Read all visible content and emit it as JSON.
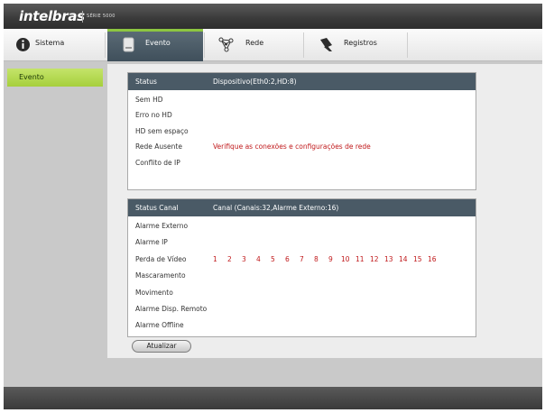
{
  "header": {
    "logo_text": "intelbras",
    "series_text": "SÉRIE 5000"
  },
  "tabs": [
    {
      "label": "Sistema",
      "icon": "info-icon"
    },
    {
      "label": "Evento",
      "icon": "hdd-icon",
      "active": true
    },
    {
      "label": "Rede",
      "icon": "network-icon"
    },
    {
      "label": "Registros",
      "icon": "log-icon"
    }
  ],
  "sidebar": {
    "items": [
      {
        "label": "Evento",
        "selected": true
      }
    ]
  },
  "status_panel": {
    "header_label": "Status",
    "header_value": "Dispositivo(Eth0:2,HD:8)",
    "rows": [
      {
        "label": "Sem HD",
        "value": ""
      },
      {
        "label": "Erro no HD",
        "value": ""
      },
      {
        "label": "HD sem espaço",
        "value": ""
      },
      {
        "label": "Rede Ausente",
        "value": "Verifique as conexões e configurações de rede"
      },
      {
        "label": "Conflito de IP",
        "value": ""
      }
    ]
  },
  "channel_panel": {
    "header_label": "Status Canal",
    "header_value": "Canal (Canais:32,Alarme Externo:16)",
    "rows": [
      {
        "label": "Alarme Externo"
      },
      {
        "label": "Alarme IP"
      },
      {
        "label": "Perda de Vídeo"
      },
      {
        "label": "Mascaramento"
      },
      {
        "label": "Movimento"
      },
      {
        "label": "Alarme Disp. Remoto"
      },
      {
        "label": "Alarme Offline"
      }
    ],
    "video_loss_channels": [
      "1",
      "2",
      "3",
      "4",
      "5",
      "6",
      "7",
      "8",
      "9",
      "10",
      "11",
      "12",
      "13",
      "14",
      "15",
      "16"
    ]
  },
  "actions": {
    "refresh_label": "Atualizar"
  },
  "colors": {
    "accent_green": "#8dc641",
    "panel_header": "#4a5a66",
    "alert_red": "#c0191b"
  }
}
